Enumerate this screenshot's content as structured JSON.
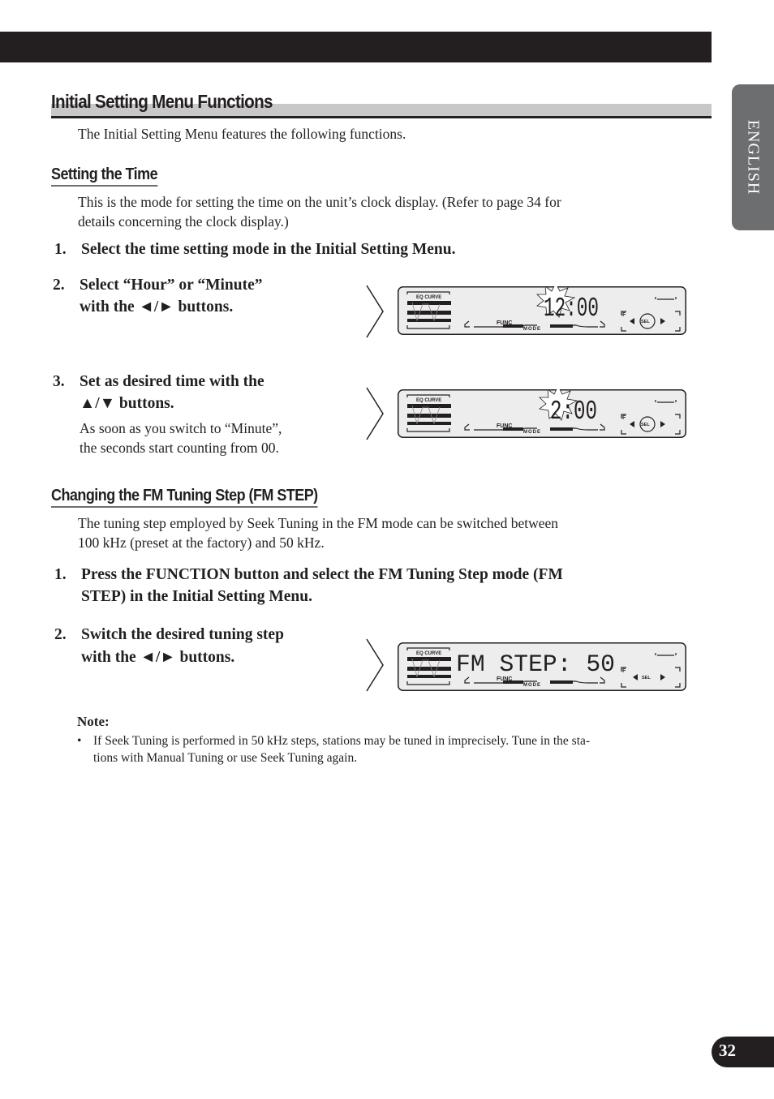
{
  "page": {
    "language_tab": "ENGLISH",
    "page_number": "32"
  },
  "section": {
    "title": "Initial Setting Menu Functions",
    "intro": "The Initial Setting Menu features the following functions."
  },
  "setting_time": {
    "heading": "Setting the Time",
    "description_line1": "This is the mode for setting the time on the unit’s clock display. (Refer to page 34 for",
    "description_line2": "details concerning the clock display.)",
    "steps": [
      {
        "num": "1.",
        "lines": [
          "Select the time setting mode in the Initial Setting Menu."
        ]
      },
      {
        "num": "2.",
        "lines": [
          "Select “Hour” or “Minute”",
          "with the ◄/► buttons."
        ]
      },
      {
        "num": "3.",
        "lines": [
          "Set as desired time with the",
          "▲/▼ buttons."
        ],
        "sub_lines": [
          "As soon as you switch to “Minute”,",
          "the seconds start counting from 00."
        ]
      }
    ],
    "displays": [
      {
        "main_text": "12:00",
        "eq_label": "EQ CURVE",
        "func_label": "FUNC",
        "mode_label": "MODE",
        "f_label": "F",
        "sel_label": "SEL"
      },
      {
        "main_text": "2:00",
        "eq_label": "EQ CURVE",
        "func_label": "FUNC",
        "mode_label": "MODE",
        "f_label": "F",
        "sel_label": "SEL"
      }
    ]
  },
  "fm_step": {
    "heading": "Changing the FM Tuning Step (FM STEP)",
    "description_line1": "The tuning step employed by Seek Tuning in the FM mode can be switched between",
    "description_line2": "100 kHz (preset at the factory) and 50 kHz.",
    "steps": [
      {
        "num": "1.",
        "lines": [
          "Press the FUNCTION button and select the FM Tuning Step mode (FM",
          "STEP) in the Initial Setting Menu."
        ]
      },
      {
        "num": "2.",
        "lines": [
          "Switch the desired tuning step",
          "with the ◄/► buttons."
        ]
      }
    ],
    "display": {
      "main_text": "FM STEP: 50",
      "eq_label": "EQ CURVE",
      "func_label": "FUNC",
      "mode_label": "MODE",
      "f_label": "F",
      "sel_label": "SEL"
    }
  },
  "note": {
    "title": "Note:",
    "bullet": "•",
    "text_line1": "If Seek Tuning is performed in 50 kHz steps, stations may be tuned in imprecisely. Tune in the sta-",
    "text_line2": "tions with Manual Tuning or use Seek Tuning again."
  }
}
